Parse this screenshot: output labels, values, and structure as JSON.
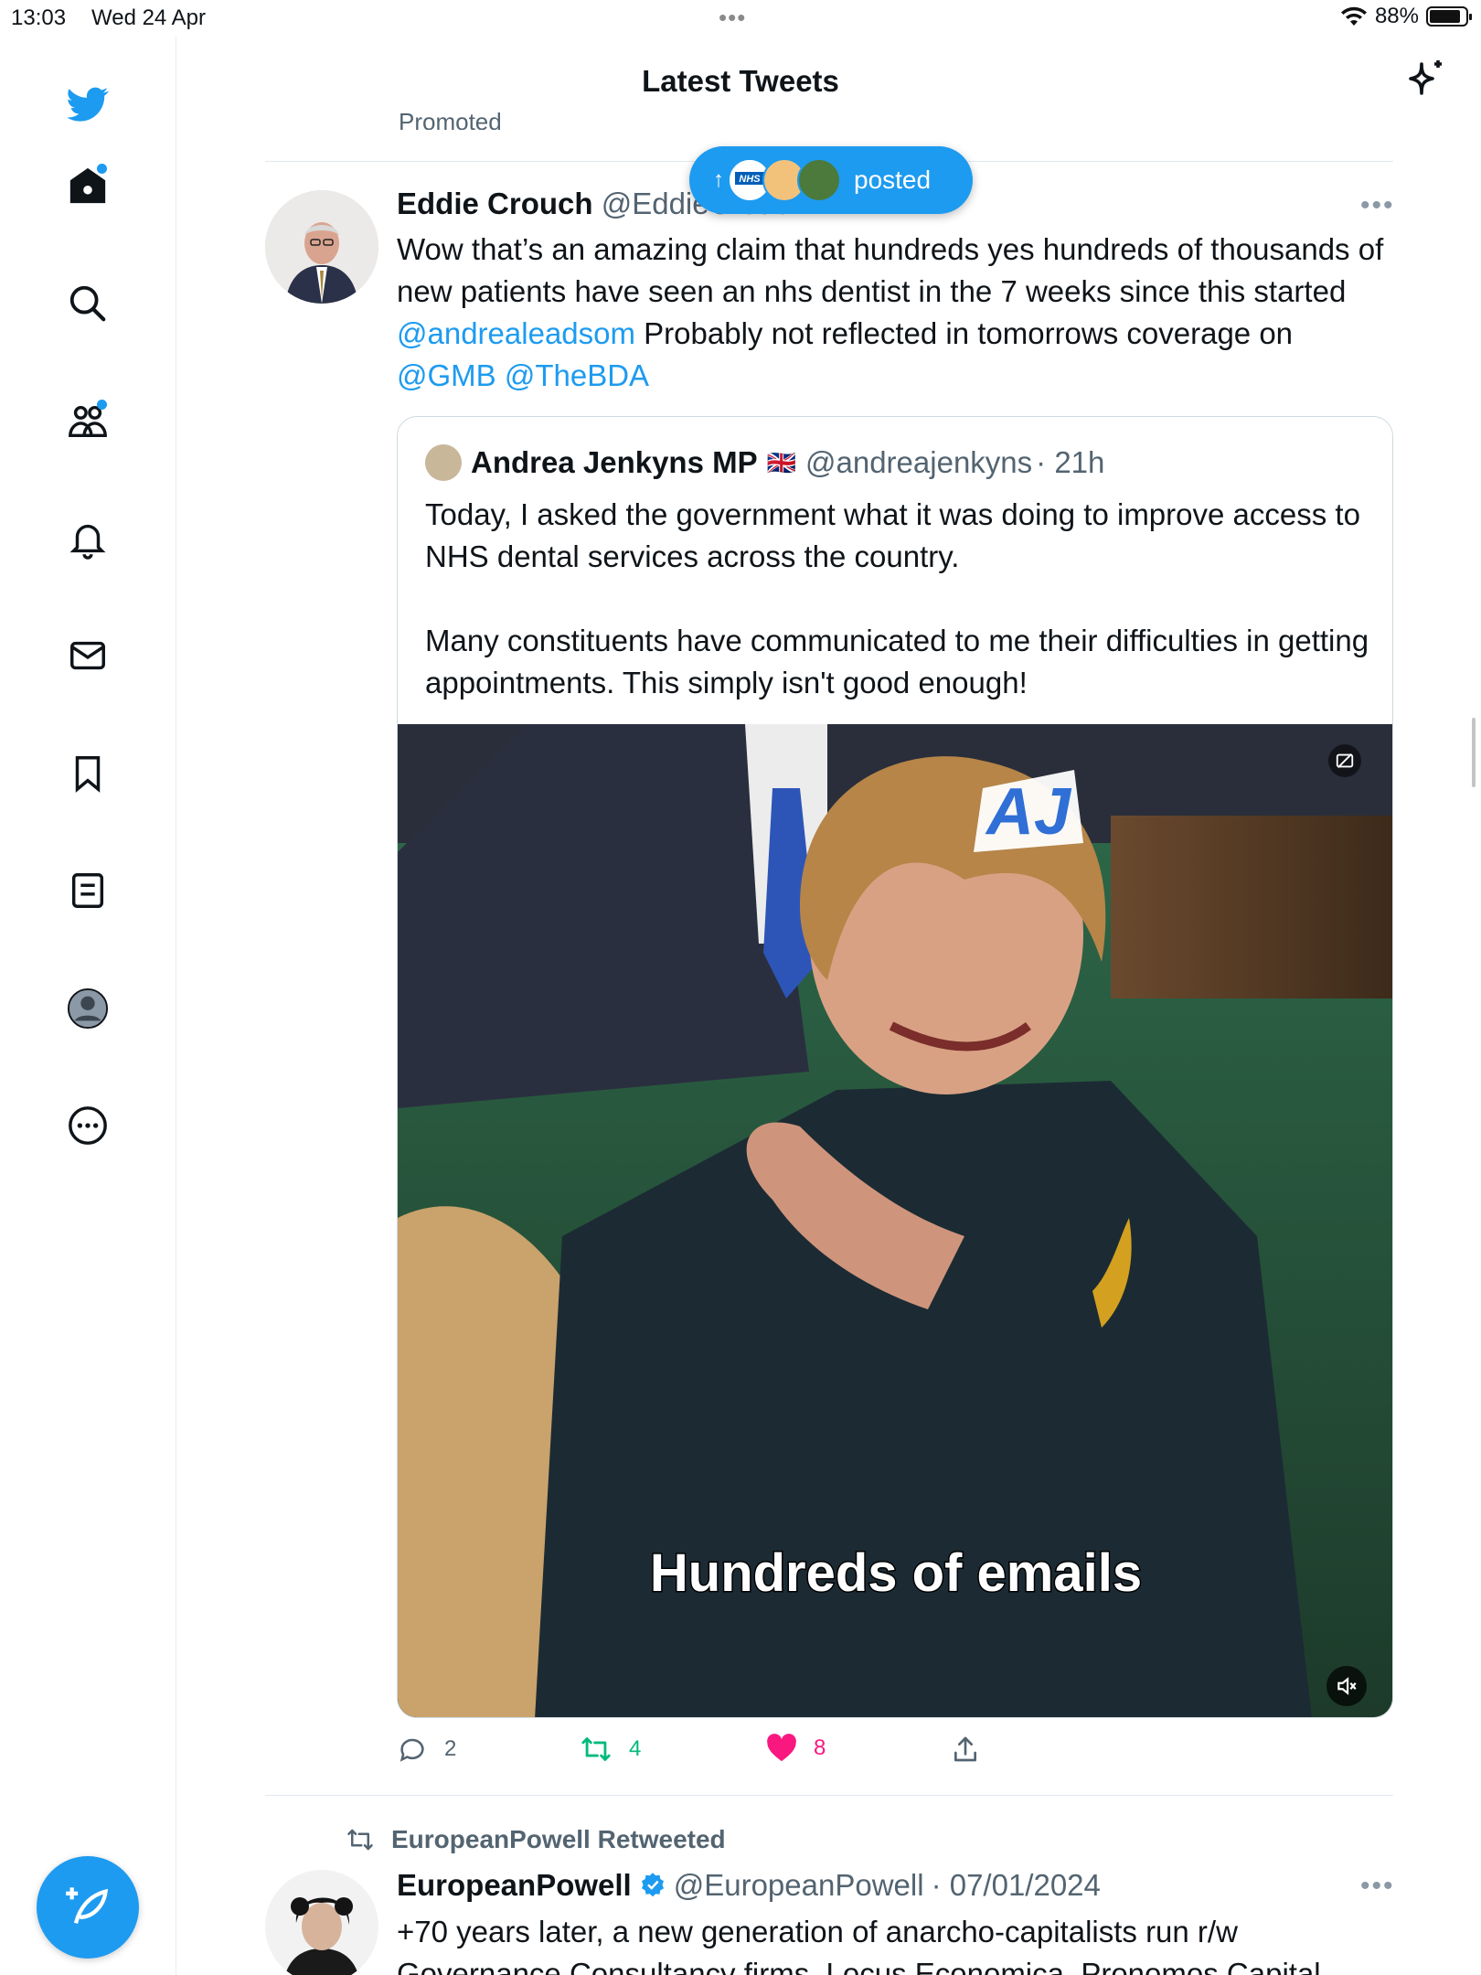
{
  "status": {
    "time": "13:03",
    "date": "Wed 24 Apr",
    "battery": "88%"
  },
  "header": {
    "title": "Latest Tweets",
    "promoted": "Promoted"
  },
  "pill": {
    "label": "posted"
  },
  "tweet1": {
    "name": "Eddie Crouch",
    "handle": "@EddieCrouch",
    "text_1": "Wow that’s an amazing claim that hundreds yes hundreds of thousands of new patients have seen an nhs dentist in the  7 weeks since this started ",
    "mention_1": "@andrealeadsom",
    "text_2": " Probably not reflected in tomorrows coverage on ",
    "mention_2": "@GMB",
    "mention_3": "@TheBDA",
    "quote": {
      "name": "Andrea Jenkyns MP",
      "flag": "🇬🇧",
      "handle": "@andreajenkyns",
      "time": "· 21h",
      "text_1": "Today, I asked the government what it was doing to improve access to NHS dental services across the country.",
      "text_2": "Many constituents have communicated to me their difficulties in getting appointments. This simply isn't good enough!",
      "media_caption": "Hundreds of emails",
      "media_logo": "AJ"
    },
    "replies": "2",
    "retweets": "4",
    "likes": "8"
  },
  "tweet2": {
    "retweeted_by": "EuropeanPowell Retweeted",
    "name": "EuropeanPowell",
    "handle": "@EuropeanPowell",
    "time": "· 07/01/2024",
    "text": "+70 years later, a new generation of anarcho-capitalists run r/w Governance Consultancy firms, Locus Economica, Pronomos Capital"
  },
  "colors": {
    "accent": "#1d9bf0",
    "retweet": "#00ba7c",
    "like": "#f91880",
    "verified": "#1d9bf0"
  }
}
